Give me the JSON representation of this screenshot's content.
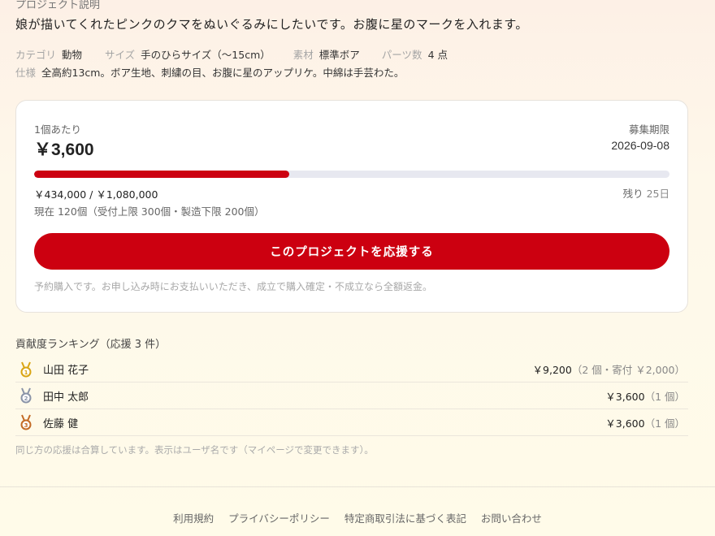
{
  "project": {
    "section_label": "プロジェクト説明",
    "description": "娘が描いてくれたピンクのクマをぬいぐるみにしたいです。お腹に星のマークを入れます。",
    "meta": {
      "category_key": "カテゴリ",
      "category_val": "動物",
      "size_key": "サイズ",
      "size_val": "手のひらサイズ（〜15cm）",
      "material_key": "素材",
      "material_val": "標準ボア",
      "parts_key": "パーツ数",
      "parts_val": "4 点",
      "spec_key": "仕様",
      "spec_val": "全高約13cm。ボア生地、刺繍の目、お腹に星のアップリケ。中綿は手芸わた。"
    }
  },
  "card": {
    "per_label": "1個あたり",
    "price": "￥3,600",
    "deadline_label": "募集期限",
    "deadline": "2026-09-08",
    "progress_fraction": 0.4019,
    "amounts": "￥434,000 / ￥1,080,000",
    "remaining_label": "残り",
    "remaining_days": "25日",
    "current": "現在 120個（受付上限 300個・製造下限 200個）",
    "button_label": "このプロジェクトを応援する",
    "note": "予約購入です。お申し込み時にお支払いいただき、成立で購入確定・不成立なら全額返金。"
  },
  "ranking": {
    "title": "貢献度ランキング（応援 3 件）",
    "rows": [
      {
        "name": "山田 花子",
        "amount": "￥9,200",
        "detail": "（2 個・寄付 ￥2,000）",
        "medal_icon": "gold-medal-icon",
        "color": "#d9a514"
      },
      {
        "name": "田中 太郎",
        "amount": "￥3,600",
        "detail": "（1 個）",
        "medal_icon": "silver-medal-icon",
        "color": "#8a94a8"
      },
      {
        "name": "佐藤 健",
        "amount": "￥3,600",
        "detail": "（1 個）",
        "medal_icon": "bronze-medal-icon",
        "color": "#c36a25"
      }
    ],
    "note": "同じ方の応援は合算しています。表示はユーザ名です（マイページで変更できます）。"
  },
  "footer": {
    "links": [
      "利用規約",
      "プライバシーポリシー",
      "特定商取引法に基づく表記",
      "お問い合わせ"
    ]
  },
  "colors": {
    "accent": "#cc0010",
    "progress_track": "#e7e8f0"
  }
}
